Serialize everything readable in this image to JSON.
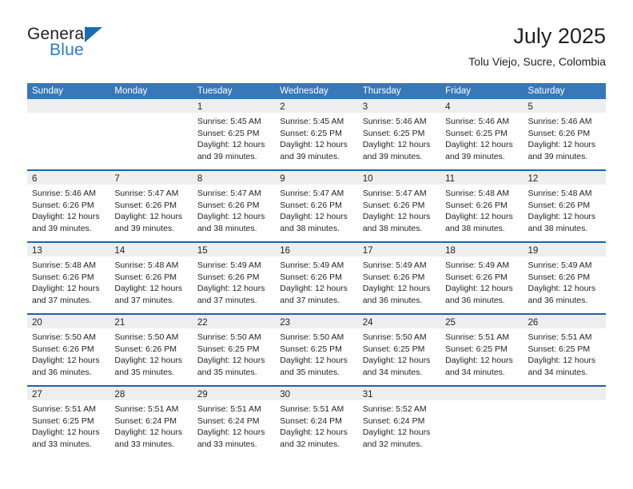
{
  "brand": {
    "line1": "General",
    "line2": "Blue",
    "triangle_color": "#1a6cb5",
    "blue_text_color": "#2a7cc7"
  },
  "header": {
    "title": "July 2025",
    "subtitle": "Tolu Viejo, Sucre, Colombia"
  },
  "theme": {
    "header_blue": "#3778b9",
    "separator_blue": "#1f64a8",
    "day_band_grey": "#eeeeee",
    "text": "#231f20"
  },
  "weekdays": [
    {
      "label": "Sunday"
    },
    {
      "label": "Monday"
    },
    {
      "label": "Tuesday"
    },
    {
      "label": "Wednesday"
    },
    {
      "label": "Thursday"
    },
    {
      "label": "Friday"
    },
    {
      "label": "Saturday"
    }
  ],
  "weeks": [
    {
      "days": [
        {
          "day": "",
          "empty": true,
          "sunrise": "",
          "sunset": "",
          "daylight_1": "",
          "daylight_2": ""
        },
        {
          "day": "",
          "empty": true,
          "sunrise": "",
          "sunset": "",
          "daylight_1": "",
          "daylight_2": ""
        },
        {
          "day": "1",
          "sunrise": "Sunrise: 5:45 AM",
          "sunset": "Sunset: 6:25 PM",
          "daylight_1": "Daylight: 12 hours",
          "daylight_2": "and 39 minutes."
        },
        {
          "day": "2",
          "sunrise": "Sunrise: 5:45 AM",
          "sunset": "Sunset: 6:25 PM",
          "daylight_1": "Daylight: 12 hours",
          "daylight_2": "and 39 minutes."
        },
        {
          "day": "3",
          "sunrise": "Sunrise: 5:46 AM",
          "sunset": "Sunset: 6:25 PM",
          "daylight_1": "Daylight: 12 hours",
          "daylight_2": "and 39 minutes."
        },
        {
          "day": "4",
          "sunrise": "Sunrise: 5:46 AM",
          "sunset": "Sunset: 6:25 PM",
          "daylight_1": "Daylight: 12 hours",
          "daylight_2": "and 39 minutes."
        },
        {
          "day": "5",
          "sunrise": "Sunrise: 5:46 AM",
          "sunset": "Sunset: 6:26 PM",
          "daylight_1": "Daylight: 12 hours",
          "daylight_2": "and 39 minutes."
        }
      ]
    },
    {
      "days": [
        {
          "day": "6",
          "sunrise": "Sunrise: 5:46 AM",
          "sunset": "Sunset: 6:26 PM",
          "daylight_1": "Daylight: 12 hours",
          "daylight_2": "and 39 minutes."
        },
        {
          "day": "7",
          "sunrise": "Sunrise: 5:47 AM",
          "sunset": "Sunset: 6:26 PM",
          "daylight_1": "Daylight: 12 hours",
          "daylight_2": "and 39 minutes."
        },
        {
          "day": "8",
          "sunrise": "Sunrise: 5:47 AM",
          "sunset": "Sunset: 6:26 PM",
          "daylight_1": "Daylight: 12 hours",
          "daylight_2": "and 38 minutes."
        },
        {
          "day": "9",
          "sunrise": "Sunrise: 5:47 AM",
          "sunset": "Sunset: 6:26 PM",
          "daylight_1": "Daylight: 12 hours",
          "daylight_2": "and 38 minutes."
        },
        {
          "day": "10",
          "sunrise": "Sunrise: 5:47 AM",
          "sunset": "Sunset: 6:26 PM",
          "daylight_1": "Daylight: 12 hours",
          "daylight_2": "and 38 minutes."
        },
        {
          "day": "11",
          "sunrise": "Sunrise: 5:48 AM",
          "sunset": "Sunset: 6:26 PM",
          "daylight_1": "Daylight: 12 hours",
          "daylight_2": "and 38 minutes."
        },
        {
          "day": "12",
          "sunrise": "Sunrise: 5:48 AM",
          "sunset": "Sunset: 6:26 PM",
          "daylight_1": "Daylight: 12 hours",
          "daylight_2": "and 38 minutes."
        }
      ]
    },
    {
      "days": [
        {
          "day": "13",
          "sunrise": "Sunrise: 5:48 AM",
          "sunset": "Sunset: 6:26 PM",
          "daylight_1": "Daylight: 12 hours",
          "daylight_2": "and 37 minutes."
        },
        {
          "day": "14",
          "sunrise": "Sunrise: 5:48 AM",
          "sunset": "Sunset: 6:26 PM",
          "daylight_1": "Daylight: 12 hours",
          "daylight_2": "and 37 minutes."
        },
        {
          "day": "15",
          "sunrise": "Sunrise: 5:49 AM",
          "sunset": "Sunset: 6:26 PM",
          "daylight_1": "Daylight: 12 hours",
          "daylight_2": "and 37 minutes."
        },
        {
          "day": "16",
          "sunrise": "Sunrise: 5:49 AM",
          "sunset": "Sunset: 6:26 PM",
          "daylight_1": "Daylight: 12 hours",
          "daylight_2": "and 37 minutes."
        },
        {
          "day": "17",
          "sunrise": "Sunrise: 5:49 AM",
          "sunset": "Sunset: 6:26 PM",
          "daylight_1": "Daylight: 12 hours",
          "daylight_2": "and 36 minutes."
        },
        {
          "day": "18",
          "sunrise": "Sunrise: 5:49 AM",
          "sunset": "Sunset: 6:26 PM",
          "daylight_1": "Daylight: 12 hours",
          "daylight_2": "and 36 minutes."
        },
        {
          "day": "19",
          "sunrise": "Sunrise: 5:49 AM",
          "sunset": "Sunset: 6:26 PM",
          "daylight_1": "Daylight: 12 hours",
          "daylight_2": "and 36 minutes."
        }
      ]
    },
    {
      "days": [
        {
          "day": "20",
          "sunrise": "Sunrise: 5:50 AM",
          "sunset": "Sunset: 6:26 PM",
          "daylight_1": "Daylight: 12 hours",
          "daylight_2": "and 36 minutes."
        },
        {
          "day": "21",
          "sunrise": "Sunrise: 5:50 AM",
          "sunset": "Sunset: 6:26 PM",
          "daylight_1": "Daylight: 12 hours",
          "daylight_2": "and 35 minutes."
        },
        {
          "day": "22",
          "sunrise": "Sunrise: 5:50 AM",
          "sunset": "Sunset: 6:25 PM",
          "daylight_1": "Daylight: 12 hours",
          "daylight_2": "and 35 minutes."
        },
        {
          "day": "23",
          "sunrise": "Sunrise: 5:50 AM",
          "sunset": "Sunset: 6:25 PM",
          "daylight_1": "Daylight: 12 hours",
          "daylight_2": "and 35 minutes."
        },
        {
          "day": "24",
          "sunrise": "Sunrise: 5:50 AM",
          "sunset": "Sunset: 6:25 PM",
          "daylight_1": "Daylight: 12 hours",
          "daylight_2": "and 34 minutes."
        },
        {
          "day": "25",
          "sunrise": "Sunrise: 5:51 AM",
          "sunset": "Sunset: 6:25 PM",
          "daylight_1": "Daylight: 12 hours",
          "daylight_2": "and 34 minutes."
        },
        {
          "day": "26",
          "sunrise": "Sunrise: 5:51 AM",
          "sunset": "Sunset: 6:25 PM",
          "daylight_1": "Daylight: 12 hours",
          "daylight_2": "and 34 minutes."
        }
      ]
    },
    {
      "days": [
        {
          "day": "27",
          "sunrise": "Sunrise: 5:51 AM",
          "sunset": "Sunset: 6:25 PM",
          "daylight_1": "Daylight: 12 hours",
          "daylight_2": "and 33 minutes."
        },
        {
          "day": "28",
          "sunrise": "Sunrise: 5:51 AM",
          "sunset": "Sunset: 6:24 PM",
          "daylight_1": "Daylight: 12 hours",
          "daylight_2": "and 33 minutes."
        },
        {
          "day": "29",
          "sunrise": "Sunrise: 5:51 AM",
          "sunset": "Sunset: 6:24 PM",
          "daylight_1": "Daylight: 12 hours",
          "daylight_2": "and 33 minutes."
        },
        {
          "day": "30",
          "sunrise": "Sunrise: 5:51 AM",
          "sunset": "Sunset: 6:24 PM",
          "daylight_1": "Daylight: 12 hours",
          "daylight_2": "and 32 minutes."
        },
        {
          "day": "31",
          "sunrise": "Sunrise: 5:52 AM",
          "sunset": "Sunset: 6:24 PM",
          "daylight_1": "Daylight: 12 hours",
          "daylight_2": "and 32 minutes."
        },
        {
          "day": "",
          "empty": true,
          "sunrise": "",
          "sunset": "",
          "daylight_1": "",
          "daylight_2": ""
        },
        {
          "day": "",
          "empty": true,
          "sunrise": "",
          "sunset": "",
          "daylight_1": "",
          "daylight_2": ""
        }
      ]
    }
  ]
}
